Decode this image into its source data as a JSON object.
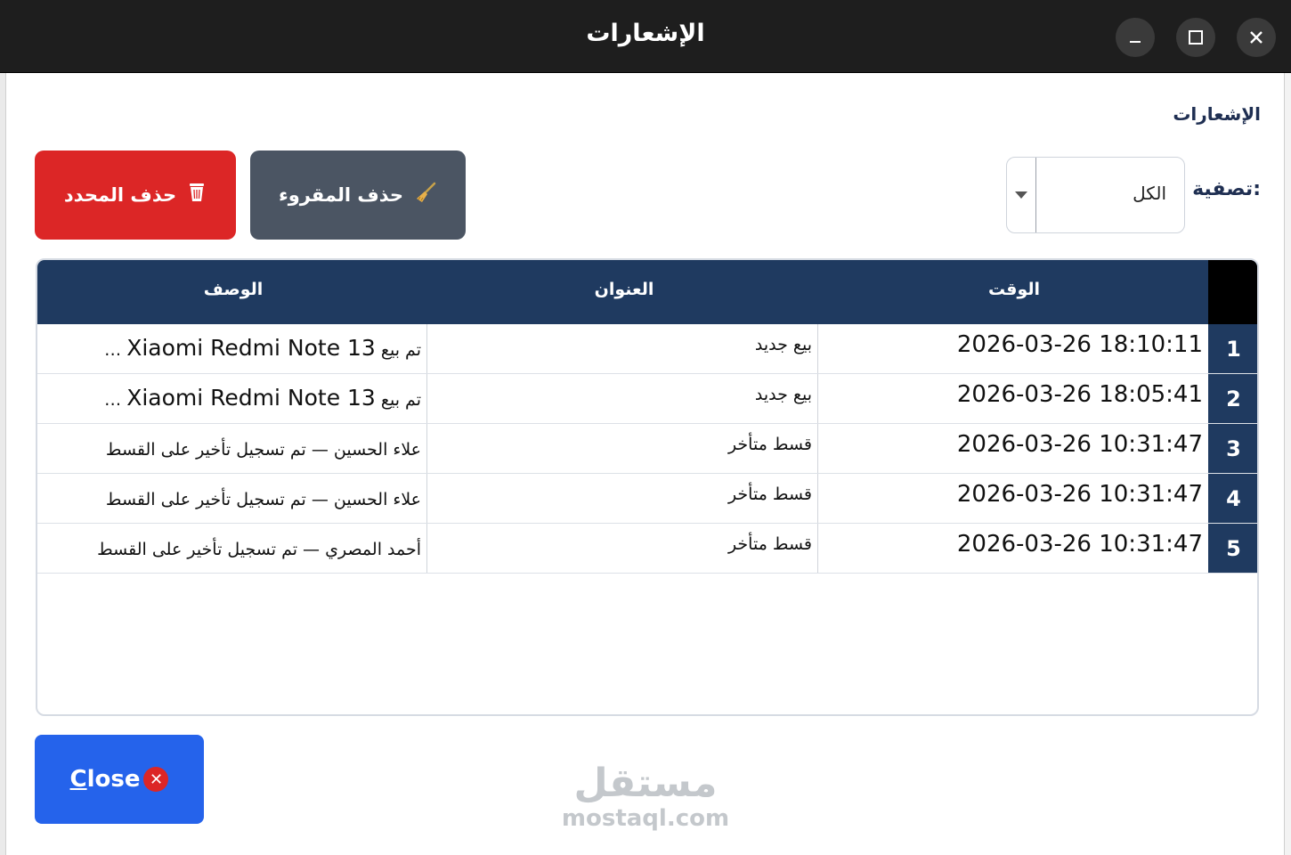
{
  "window": {
    "title": "الإشعارات"
  },
  "page": {
    "section_label": "الإشعارات",
    "filter_label": "تصفية:",
    "filter_value": "الكل"
  },
  "toolbar": {
    "delete_selected_label": "حذف المحدد",
    "delete_read_label": "حذف المقروء"
  },
  "table": {
    "headers": {
      "time": "الوقت",
      "title": "العنوان",
      "description": "الوصف"
    },
    "rows": [
      {
        "num": "1",
        "time": "2026-03-26 18:10:11",
        "title": "بيع جديد",
        "desc_prefix": "تم بيع ",
        "desc_latin": "Xiaomi Redmi Note 13",
        "desc_suffix": " …"
      },
      {
        "num": "2",
        "time": "2026-03-26 18:05:41",
        "title": "بيع جديد",
        "desc_prefix": "تم بيع ",
        "desc_latin": "Xiaomi Redmi Note 13",
        "desc_suffix": " …"
      },
      {
        "num": "3",
        "time": "2026-03-26 10:31:47",
        "title": "قسط متأخر",
        "desc_prefix": "علاء الحسين — تم تسجيل تأخير على القسط",
        "desc_latin": "",
        "desc_suffix": ""
      },
      {
        "num": "4",
        "time": "2026-03-26 10:31:47",
        "title": "قسط متأخر",
        "desc_prefix": "علاء الحسين — تم تسجيل تأخير على القسط",
        "desc_latin": "",
        "desc_suffix": ""
      },
      {
        "num": "5",
        "time": "2026-03-26 10:31:47",
        "title": "قسط متأخر",
        "desc_prefix": "أحمد المصري — تم تسجيل تأخير على القسط",
        "desc_latin": "",
        "desc_suffix": ""
      }
    ]
  },
  "footer": {
    "close_mnemonic": "C",
    "close_rest": "lose"
  },
  "watermark": {
    "arabic": "مستقل",
    "latin": "mostaql.com"
  },
  "colors": {
    "titlebar": "#1e1e1e",
    "table_header": "#1f3a60",
    "delete_selected": "#dc2626",
    "delete_read": "#4b5563",
    "close": "#2563eb"
  },
  "icons": {
    "delete_selected": "trash-icon",
    "delete_read": "broom-icon",
    "close": "close-circle-icon"
  }
}
